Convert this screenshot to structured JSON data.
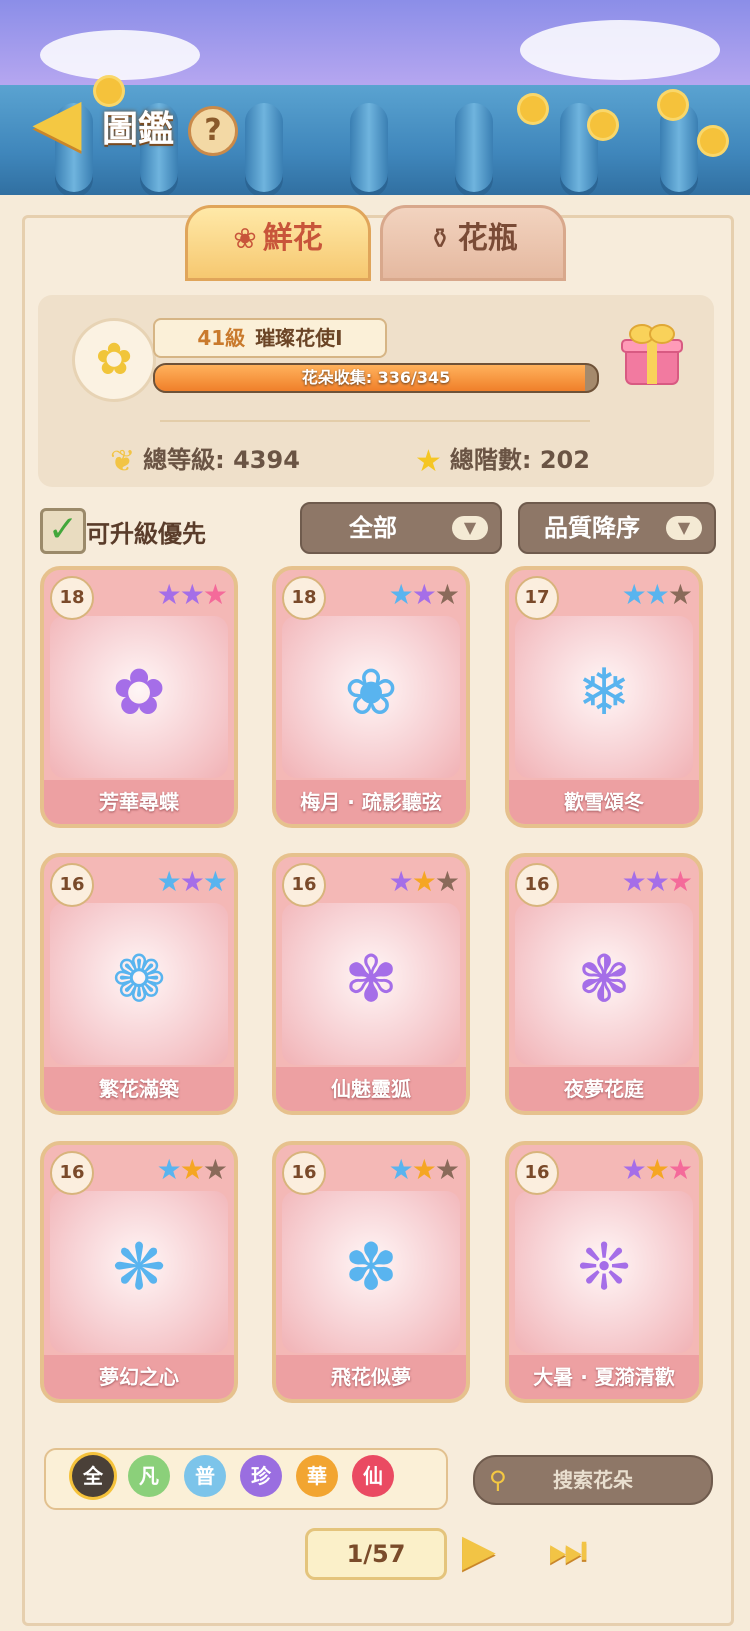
{
  "header": {
    "title": "圖鑑",
    "help_label": "?",
    "back_icon": "back-arrow-icon"
  },
  "tabs": [
    {
      "label": "鮮花",
      "icon": "rose-icon",
      "active": true
    },
    {
      "label": "花瓶",
      "icon": "vase-icon",
      "active": false
    }
  ],
  "summary": {
    "level_number": "41級",
    "level_title": "璀璨花使Ⅰ",
    "collection_text": "花朵收集: 336/345",
    "collected": 336,
    "total": 345,
    "total_level_label": "總等級: 4394",
    "total_rank_label": "總階數: 202"
  },
  "filters": {
    "upgrade_priority_label": "可升級優先",
    "upgrade_priority_checked": true,
    "category_value": "全部",
    "sort_value": "品質降序"
  },
  "cards": [
    {
      "level": "18",
      "name": "芳華尋蝶",
      "stars": [
        "purple",
        "purple",
        "pink"
      ]
    },
    {
      "level": "18",
      "name": "梅月 · 疏影聽弦",
      "stars": [
        "blue",
        "purple",
        "brown"
      ]
    },
    {
      "level": "17",
      "name": "歡雪頌冬",
      "stars": [
        "blue",
        "blue",
        "brown"
      ]
    },
    {
      "level": "16",
      "name": "繁花滿築",
      "stars": [
        "blue",
        "purple",
        "blue"
      ]
    },
    {
      "level": "16",
      "name": "仙魅靈狐",
      "stars": [
        "purple",
        "orange",
        "brown"
      ]
    },
    {
      "level": "16",
      "name": "夜夢花庭",
      "stars": [
        "purple",
        "purple",
        "pink"
      ]
    },
    {
      "level": "16",
      "name": "夢幻之心",
      "stars": [
        "blue",
        "orange",
        "brown"
      ]
    },
    {
      "level": "16",
      "name": "飛花似夢",
      "stars": [
        "blue",
        "orange",
        "brown"
      ]
    },
    {
      "level": "16",
      "name": "大暑 · 夏漪清歡",
      "stars": [
        "purple",
        "orange",
        "pink"
      ]
    }
  ],
  "rarity_filters": [
    {
      "label": "全",
      "color": "#4a4038"
    },
    {
      "label": "凡",
      "color": "#8bd07a"
    },
    {
      "label": "普",
      "color": "#7cc4ea"
    },
    {
      "label": "珍",
      "color": "#9a6ee0"
    },
    {
      "label": "華",
      "color": "#f2a531"
    },
    {
      "label": "仙",
      "color": "#ea4a62"
    }
  ],
  "search_placeholder": "搜索花朵",
  "pagination": {
    "label": "1/57",
    "current": 1,
    "total": 57
  },
  "colors": {
    "star_purple": "#a56ee8",
    "star_blue": "#59b4ef",
    "star_pink": "#f46a9a",
    "star_orange": "#f5a623",
    "star_brown": "#8a6a5a"
  }
}
